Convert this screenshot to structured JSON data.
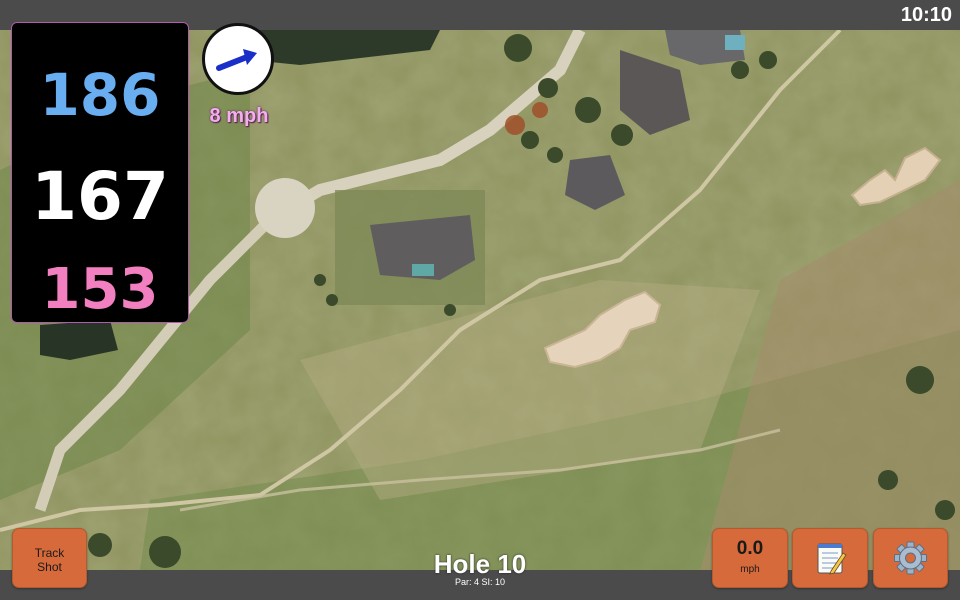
{
  "status_bar": {
    "time": "10:10"
  },
  "distances": {
    "back": "186",
    "middle": "167",
    "front": "153"
  },
  "wind": {
    "speed_label": "8 mph",
    "icon": "wind-direction-arrow-icon"
  },
  "hole": {
    "title": "Hole 10",
    "details": "Par: 4   SI: 10"
  },
  "buttons": {
    "track_shot_line1": "Track",
    "track_shot_line2": "Shot",
    "speed_value": "0.0",
    "speed_unit": "mph",
    "notes_icon": "notepad-icon",
    "settings_icon": "gear-icon"
  },
  "colors": {
    "back_distance": "#6aaef2",
    "middle_distance": "#ffffff",
    "front_distance": "#f27fc0",
    "wind_label": "#f3aef0",
    "button_bg": "#d76a3a",
    "bar_bg": "#4b4b4b"
  }
}
